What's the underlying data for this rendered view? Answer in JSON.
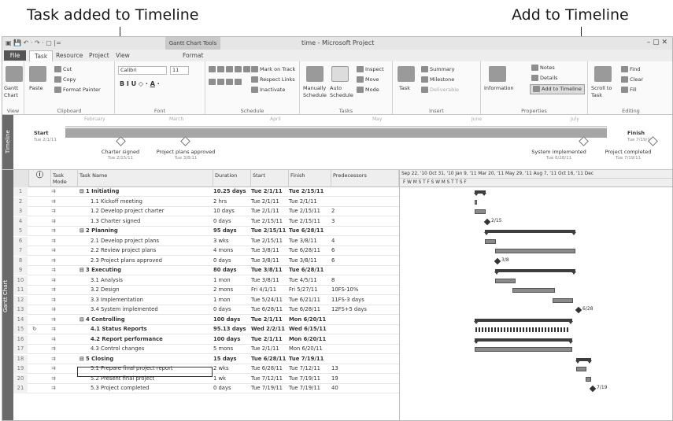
{
  "callouts": {
    "left": "Task added to Timeline",
    "right": "Add to Timeline"
  },
  "window": {
    "title": "time - Microsoft Project",
    "context_tab": "Gantt Chart Tools",
    "tabs": [
      "File",
      "Task",
      "Resource",
      "Project",
      "View",
      "Format"
    ],
    "active_tab": "Task"
  },
  "ribbon": {
    "view": {
      "gantt": "Gantt Chart",
      "label": "View"
    },
    "clipboard": {
      "paste": "Paste",
      "cut": "Cut",
      "copy": "Copy",
      "format_painter": "Format Painter",
      "label": "Clipboard"
    },
    "font": {
      "name": "Calibri",
      "size": "11",
      "label": "Font"
    },
    "schedule": {
      "mark_on_track": "Mark on Track",
      "respect_links": "Respect Links",
      "inactivate": "Inactivate",
      "label": "Schedule"
    },
    "tasks": {
      "manually": "Manually Schedule",
      "auto": "Auto Schedule",
      "inspect": "Inspect",
      "move": "Move",
      "mode": "Mode",
      "label": "Tasks"
    },
    "insert": {
      "task": "Task",
      "summary": "Summary",
      "milestone": "Milestone",
      "deliverable": "Deliverable",
      "label": "Insert"
    },
    "properties": {
      "information": "Information",
      "notes": "Notes",
      "details": "Details",
      "add_to_timeline": "Add to Timeline",
      "label": "Properties"
    },
    "editing": {
      "scroll": "Scroll to Task",
      "find": "Find",
      "clear": "Clear",
      "fill": "Fill",
      "label": "Editing"
    }
  },
  "timeline": {
    "label": "Timeline",
    "months": [
      "February",
      "March",
      "April",
      "May",
      "June",
      "July"
    ],
    "start": {
      "label": "Start",
      "date": "Tue 2/1/11"
    },
    "finish": {
      "label": "Finish",
      "date": "Tue 7/19/11"
    },
    "milestones": [
      {
        "name": "Charter signed",
        "date": "Tue 2/15/11"
      },
      {
        "name": "Project plans approved",
        "date": "Tue 3/8/11"
      },
      {
        "name": "System implemented",
        "date": "Tue 6/28/11"
      },
      {
        "name": "Project completed",
        "date": "Tue 7/19/11"
      }
    ]
  },
  "table": {
    "side_label": "Gantt Chart",
    "headers": {
      "task_mode": "Task Mode",
      "task_name": "Task Name",
      "duration": "Duration",
      "start": "Start",
      "finish": "Finish",
      "predecessors": "Predecessors"
    },
    "rows": [
      {
        "id": "1",
        "name": "1 Initiating",
        "dur": "10.25 days",
        "start": "Tue 2/1/11",
        "finish": "Tue 2/15/11",
        "pred": "",
        "level": 0,
        "summary": true
      },
      {
        "id": "2",
        "name": "1.1 Kickoff meeting",
        "dur": "2 hrs",
        "start": "Tue 2/1/11",
        "finish": "Tue 2/1/11",
        "pred": "",
        "level": 1
      },
      {
        "id": "3",
        "name": "1.2 Develop project charter",
        "dur": "10 days",
        "start": "Tue 2/1/11",
        "finish": "Tue 2/15/11",
        "pred": "2",
        "level": 1
      },
      {
        "id": "4",
        "name": "1.3 Charter signed",
        "dur": "0 days",
        "start": "Tue 2/15/11",
        "finish": "Tue 2/15/11",
        "pred": "3",
        "level": 1
      },
      {
        "id": "5",
        "name": "2 Planning",
        "dur": "95 days",
        "start": "Tue 2/15/11",
        "finish": "Tue 6/28/11",
        "pred": "",
        "level": 0,
        "summary": true
      },
      {
        "id": "6",
        "name": "2.1 Develop project plans",
        "dur": "3 wks",
        "start": "Tue 2/15/11",
        "finish": "Tue 3/8/11",
        "pred": "4",
        "level": 1
      },
      {
        "id": "7",
        "name": "2.2 Review project plans",
        "dur": "4 mons",
        "start": "Tue 3/8/11",
        "finish": "Tue 6/28/11",
        "pred": "6",
        "level": 1
      },
      {
        "id": "8",
        "name": "2.3 Project plans approved",
        "dur": "0 days",
        "start": "Tue 3/8/11",
        "finish": "Tue 3/8/11",
        "pred": "6",
        "level": 1
      },
      {
        "id": "9",
        "name": "3 Executing",
        "dur": "80 days",
        "start": "Tue 3/8/11",
        "finish": "Tue 6/28/11",
        "pred": "",
        "level": 0,
        "summary": true
      },
      {
        "id": "10",
        "name": "3.1 Analysis",
        "dur": "1 mon",
        "start": "Tue 3/8/11",
        "finish": "Tue 4/5/11",
        "pred": "8",
        "level": 1
      },
      {
        "id": "11",
        "name": "3.2 Design",
        "dur": "2 mons",
        "start": "Fri 4/1/11",
        "finish": "Fri 5/27/11",
        "pred": "10FS-10%",
        "level": 1
      },
      {
        "id": "12",
        "name": "3.3 Implementation",
        "dur": "1 mon",
        "start": "Tue 5/24/11",
        "finish": "Tue 6/21/11",
        "pred": "11FS-3 days",
        "level": 1
      },
      {
        "id": "13",
        "name": "3.4 System implemented",
        "dur": "0 days",
        "start": "Tue 6/28/11",
        "finish": "Tue 6/28/11",
        "pred": "12FS+5 days",
        "level": 1
      },
      {
        "id": "14",
        "name": "4 Controlling",
        "dur": "100 days",
        "start": "Tue 2/1/11",
        "finish": "Mon 6/20/11",
        "pred": "",
        "level": 0,
        "summary": true
      },
      {
        "id": "15",
        "name": "4.1 Status Reports",
        "dur": "95.13 days",
        "start": "Wed 2/2/11",
        "finish": "Wed 6/15/11",
        "pred": "",
        "level": 1,
        "summary": true,
        "info": "↻"
      },
      {
        "id": "16",
        "name": "4.2 Report performance",
        "dur": "100 days",
        "start": "Tue 2/1/11",
        "finish": "Mon 6/20/11",
        "pred": "",
        "level": 1,
        "summary": true
      },
      {
        "id": "17",
        "name": "4.3 Control changes",
        "dur": "5 mons",
        "start": "Tue 2/1/11",
        "finish": "Mon 6/20/11",
        "pred": "",
        "level": 1
      },
      {
        "id": "18",
        "name": "5 Closing",
        "dur": "15 days",
        "start": "Tue 6/28/11",
        "finish": "Tue 7/19/11",
        "pred": "",
        "level": 0,
        "summary": true
      },
      {
        "id": "19",
        "name": "5.1 Prepare final project report",
        "dur": "2 wks",
        "start": "Tue 6/28/11",
        "finish": "Tue 7/12/11",
        "pred": "13",
        "level": 1
      },
      {
        "id": "20",
        "name": "5.2 Present final project",
        "dur": "1 wk",
        "start": "Tue 7/12/11",
        "finish": "Tue 7/19/11",
        "pred": "19",
        "level": 1
      },
      {
        "id": "21",
        "name": "5.3 Project completed",
        "dur": "0 days",
        "start": "Tue 7/19/11",
        "finish": "Tue 7/19/11",
        "pred": "40",
        "level": 1
      }
    ]
  },
  "gantt": {
    "scale_top": "Sep 22, '10  Oct 31, '10  Jan 9, '11  Mar 20, '11  May 29, '11  Aug 7, '11  Oct 16, '11  Dec",
    "scale_bottom": "F    W    M    S    T    F    S    W    M    S    T    T    S    F",
    "milestone_labels": [
      "2/15",
      "3/8",
      "6/28",
      "7/19"
    ]
  }
}
